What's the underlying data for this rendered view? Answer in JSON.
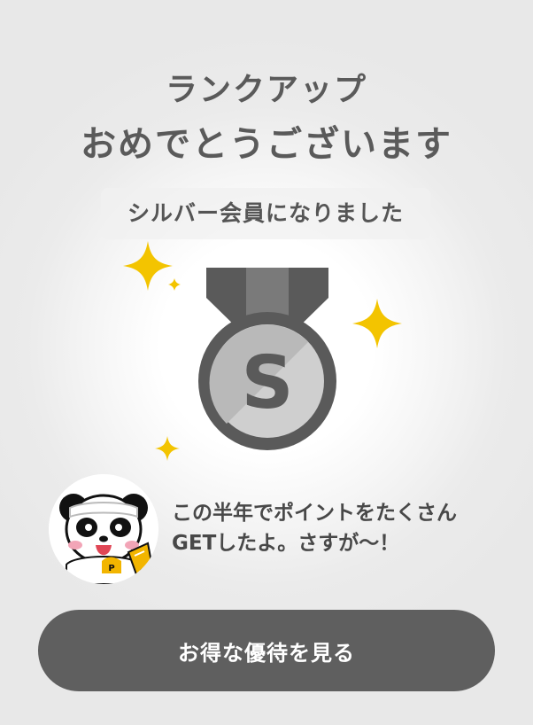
{
  "header": {
    "line1": "ランクアップ",
    "line2": "おめでとうございます"
  },
  "rank": {
    "message": "シルバー会員になりました",
    "medal_letter": "S"
  },
  "mascot": {
    "icon": "panda-mascot-icon",
    "message_line1": "この半年でポイントをたくさん",
    "message_line2": "GETしたよ。さすが〜！"
  },
  "cta": {
    "label": "お得な優待を見る"
  },
  "colors": {
    "background": "#e8e8e8",
    "text": "#5a5a5a",
    "button": "#5f5f5f",
    "medal_dark": "#5a5a5a",
    "medal_light": "#c7c7c7",
    "sparkle": "#f3c400"
  }
}
